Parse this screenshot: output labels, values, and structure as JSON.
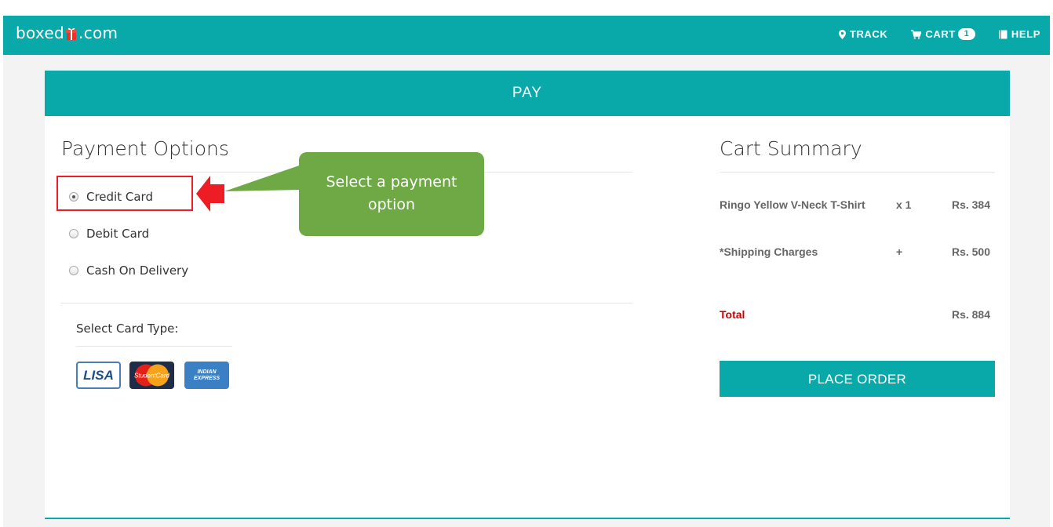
{
  "colors": {
    "accent": "#0aa9a9",
    "callout": "#6ea945",
    "highlight": "#ee1c24",
    "total": "#cc0000"
  },
  "nav": {
    "brand_left": "boxed",
    "brand_right": ".com",
    "track": "TRACK",
    "cart": "CART",
    "cart_count": "1",
    "help": "HELP"
  },
  "header": {
    "title": "PAY"
  },
  "payment": {
    "title": "Payment Options",
    "options": [
      {
        "label": "Credit Card",
        "selected": true
      },
      {
        "label": "Debit Card",
        "selected": false
      },
      {
        "label": "Cash On Delivery",
        "selected": false
      }
    ],
    "card_type_label": "Select Card Type:",
    "card_logos": [
      {
        "icon": "visa-card-icon",
        "text": "LISA"
      },
      {
        "icon": "mastercard-card-icon",
        "text": "StudentCard"
      },
      {
        "icon": "amex-card-icon",
        "text": "INDIAN EXPRESS"
      }
    ]
  },
  "callout": {
    "text_line1": "Select a payment",
    "text_line2": "option"
  },
  "summary": {
    "title": "Cart Summary",
    "items": [
      {
        "name": "Ringo Yellow V-Neck T-Shirt",
        "qty": "x 1",
        "price": "Rs. 384"
      },
      {
        "name": "*Shipping Charges",
        "qty": "+",
        "price": "Rs. 500"
      }
    ],
    "total_label": "Total",
    "total_value": "Rs. 884",
    "place_order": "PLACE ORDER"
  }
}
